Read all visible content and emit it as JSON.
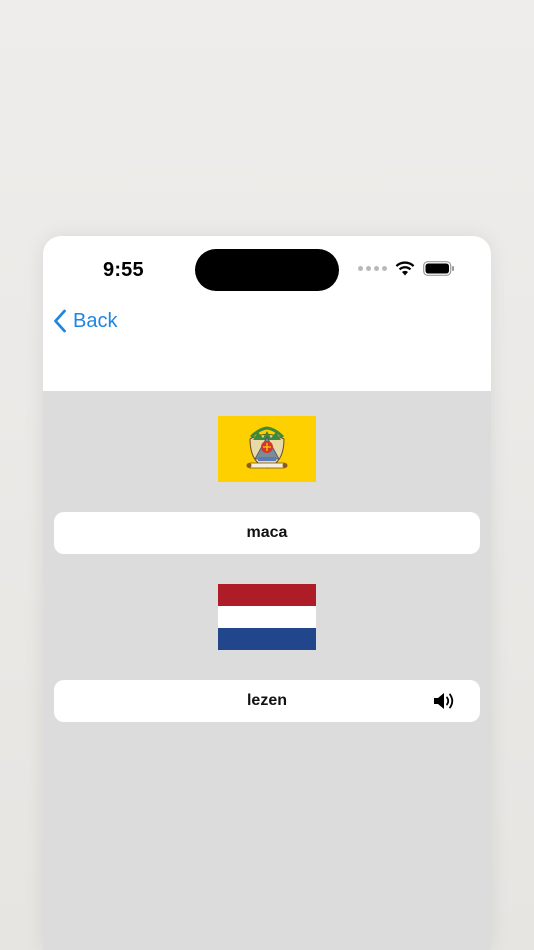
{
  "status_bar": {
    "time": "9:55"
  },
  "nav": {
    "back_label": "Back"
  },
  "cards": {
    "source_word": "maca",
    "target_word": "lezen"
  },
  "flags": {
    "source": "central-java-flag",
    "target": "netherlands-flag"
  },
  "colors": {
    "accent": "#1f86e0",
    "background": "#dcdcdc",
    "java_flag_yellow": "#ffd000",
    "nl_red": "#ae1c28",
    "nl_white": "#ffffff",
    "nl_blue": "#21468b"
  },
  "icons": {
    "back": "chevron-left-icon",
    "speaker": "speaker-icon",
    "wifi": "wifi-icon",
    "battery": "battery-icon"
  }
}
